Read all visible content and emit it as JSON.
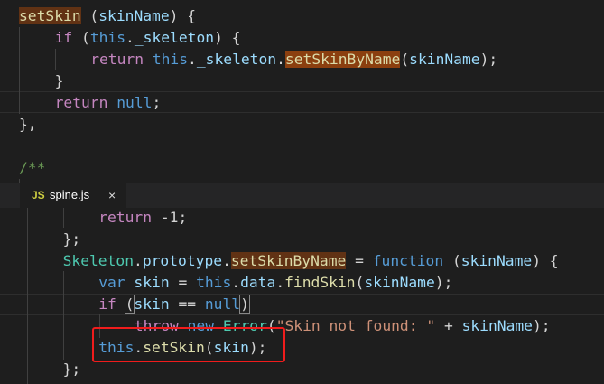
{
  "colors": {
    "background": "#1e1e1e",
    "keyword": "#c586c0",
    "storage": "#569cd6",
    "function": "#dcdcaa",
    "variable": "#9cdcfe",
    "string": "#ce9178",
    "class": "#4ec9b0",
    "comment": "#6a9955",
    "highlight_box": "#f01c1c"
  },
  "top_editor": {
    "lines": [
      {
        "indent": 0,
        "tokens": [
          {
            "t": "setSkin",
            "c": "fn hl1"
          },
          {
            "t": " (",
            "c": "pl"
          },
          {
            "t": "skinName",
            "c": "vr"
          },
          {
            "t": ") {",
            "c": "pl"
          }
        ]
      },
      {
        "indent": 1,
        "tokens": [
          {
            "t": "if",
            "c": "kw"
          },
          {
            "t": " (",
            "c": "pl"
          },
          {
            "t": "this",
            "c": "bl"
          },
          {
            "t": ".",
            "c": "pl"
          },
          {
            "t": "_skeleton",
            "c": "vr"
          },
          {
            "t": ") {",
            "c": "pl"
          }
        ]
      },
      {
        "indent": 2,
        "tokens": [
          {
            "t": "return",
            "c": "kw"
          },
          {
            "t": " ",
            "c": "pl"
          },
          {
            "t": "this",
            "c": "bl"
          },
          {
            "t": ".",
            "c": "pl"
          },
          {
            "t": "_skeleton",
            "c": "vr"
          },
          {
            "t": ".",
            "c": "pl"
          },
          {
            "t": "setSkinByName",
            "c": "fn hl2"
          },
          {
            "t": "(",
            "c": "pl"
          },
          {
            "t": "skinName",
            "c": "vr"
          },
          {
            "t": ");",
            "c": "pl"
          }
        ]
      },
      {
        "indent": 1,
        "tokens": [
          {
            "t": "}",
            "c": "pl"
          }
        ]
      },
      {
        "indent": 1,
        "tokens": [
          {
            "t": "return",
            "c": "kw"
          },
          {
            "t": " ",
            "c": "pl"
          },
          {
            "t": "null",
            "c": "bl"
          },
          {
            "t": ";",
            "c": "pl"
          }
        ]
      },
      {
        "indent": 0,
        "tokens": [
          {
            "t": "},",
            "c": "pl"
          }
        ]
      },
      {
        "indent": 0,
        "tokens": []
      },
      {
        "indent": 0,
        "tokens": [
          {
            "t": "/**",
            "c": "cm"
          }
        ]
      }
    ]
  },
  "tab": {
    "icon": "JS",
    "filename": "spine.js",
    "close": "×"
  },
  "bottom_editor": {
    "lines": [
      {
        "indent": 2,
        "tokens": [
          {
            "t": "return",
            "c": "kw"
          },
          {
            "t": " -",
            "c": "pl"
          },
          {
            "t": "1",
            "c": "pl"
          },
          {
            "t": ";",
            "c": "pl"
          }
        ]
      },
      {
        "indent": 1,
        "tokens": [
          {
            "t": "};",
            "c": "pl"
          }
        ]
      },
      {
        "indent": 1,
        "tokens": [
          {
            "t": "Skeleton",
            "c": "cl"
          },
          {
            "t": ".",
            "c": "pl"
          },
          {
            "t": "prototype",
            "c": "vr"
          },
          {
            "t": ".",
            "c": "pl"
          },
          {
            "t": "setSkinByName",
            "c": "fn hl1"
          },
          {
            "t": " = ",
            "c": "pl"
          },
          {
            "t": "function",
            "c": "bl"
          },
          {
            "t": " (",
            "c": "pl"
          },
          {
            "t": "skinName",
            "c": "vr"
          },
          {
            "t": ") {",
            "c": "pl"
          }
        ]
      },
      {
        "indent": 2,
        "tokens": [
          {
            "t": "var",
            "c": "bl"
          },
          {
            "t": " ",
            "c": "pl"
          },
          {
            "t": "skin",
            "c": "vr"
          },
          {
            "t": " = ",
            "c": "pl"
          },
          {
            "t": "this",
            "c": "bl"
          },
          {
            "t": ".",
            "c": "pl"
          },
          {
            "t": "data",
            "c": "vr"
          },
          {
            "t": ".",
            "c": "pl"
          },
          {
            "t": "findSkin",
            "c": "fn"
          },
          {
            "t": "(",
            "c": "pl"
          },
          {
            "t": "skinName",
            "c": "vr"
          },
          {
            "t": ");",
            "c": "pl"
          }
        ]
      },
      {
        "indent": 2,
        "tokens": [
          {
            "t": "if",
            "c": "kw"
          },
          {
            "t": " ",
            "c": "pl"
          },
          {
            "t": "(",
            "c": "pl br"
          },
          {
            "t": "skin",
            "c": "vr"
          },
          {
            "t": " == ",
            "c": "pl"
          },
          {
            "t": "null",
            "c": "bl"
          },
          {
            "t": ")",
            "c": "pl br"
          }
        ]
      },
      {
        "indent": 3,
        "tokens": [
          {
            "t": "throw",
            "c": "kw"
          },
          {
            "t": " ",
            "c": "pl"
          },
          {
            "t": "new",
            "c": "bl"
          },
          {
            "t": " ",
            "c": "pl"
          },
          {
            "t": "Error",
            "c": "cl"
          },
          {
            "t": "(",
            "c": "pl"
          },
          {
            "t": "\"Skin not found: \"",
            "c": "st"
          },
          {
            "t": " + ",
            "c": "pl"
          },
          {
            "t": "skinName",
            "c": "vr"
          },
          {
            "t": ");",
            "c": "pl"
          }
        ]
      },
      {
        "indent": 2,
        "tokens": [
          {
            "t": "this",
            "c": "bl"
          },
          {
            "t": ".",
            "c": "pl"
          },
          {
            "t": "setSkin",
            "c": "fn"
          },
          {
            "t": "(",
            "c": "pl"
          },
          {
            "t": "skin",
            "c": "vr"
          },
          {
            "t": ");",
            "c": "pl"
          }
        ]
      },
      {
        "indent": 1,
        "tokens": [
          {
            "t": "};",
            "c": "pl"
          }
        ]
      }
    ]
  }
}
